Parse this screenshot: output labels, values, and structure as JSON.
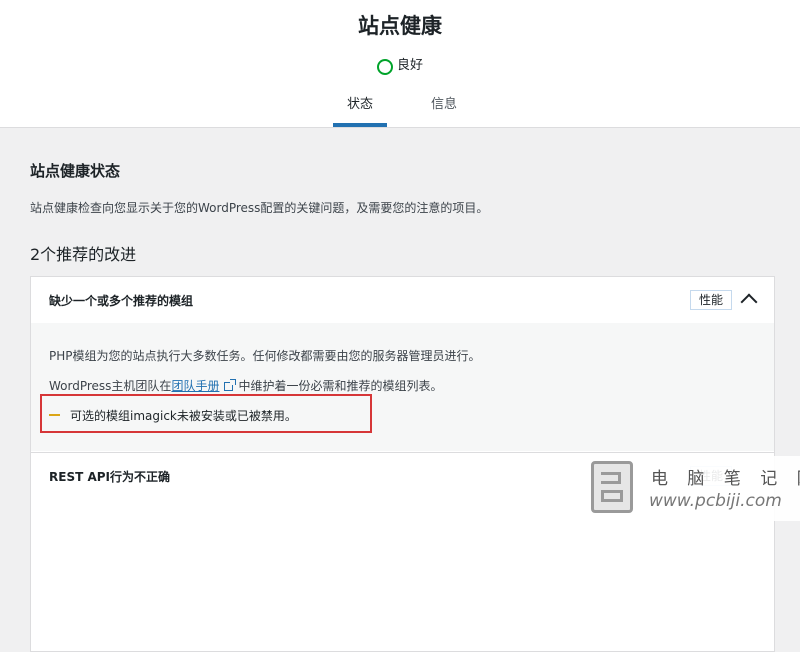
{
  "header": {
    "title": "站点健康",
    "status": "良好",
    "tabs": [
      {
        "label": "状态",
        "active": true
      },
      {
        "label": "信息",
        "active": false
      }
    ]
  },
  "main": {
    "section_title": "站点健康状态",
    "description": "站点健康检查向您显示关于您的WordPress配置的关键问题，及需要您的注意的项目。",
    "improvements_heading": "2个推荐的改进",
    "items": [
      {
        "title": "缺少一个或多个推荐的模组",
        "badge": "性能",
        "expanded": true,
        "body_line1": "PHP模组为您的站点执行大多数任务。任何修改都需要由您的服务器管理员进行。",
        "body_line2_prefix": "WordPress主机团队在",
        "body_link": "团队手册",
        "body_line2_suffix": "中维护着一份必需和推荐的模组列表。",
        "warning": "可选的模组imagick未被安装或已被禁用。"
      },
      {
        "title": "REST API行为不正确",
        "badge": "性能",
        "expanded": false
      }
    ]
  },
  "watermark": {
    "text": "电 脑 笔 记 网",
    "url": "www.pcbiji.com"
  },
  "colors": {
    "accent": "#2271b1",
    "good": "#00a32a",
    "warning": "#dba617",
    "highlight": "#d63638"
  }
}
